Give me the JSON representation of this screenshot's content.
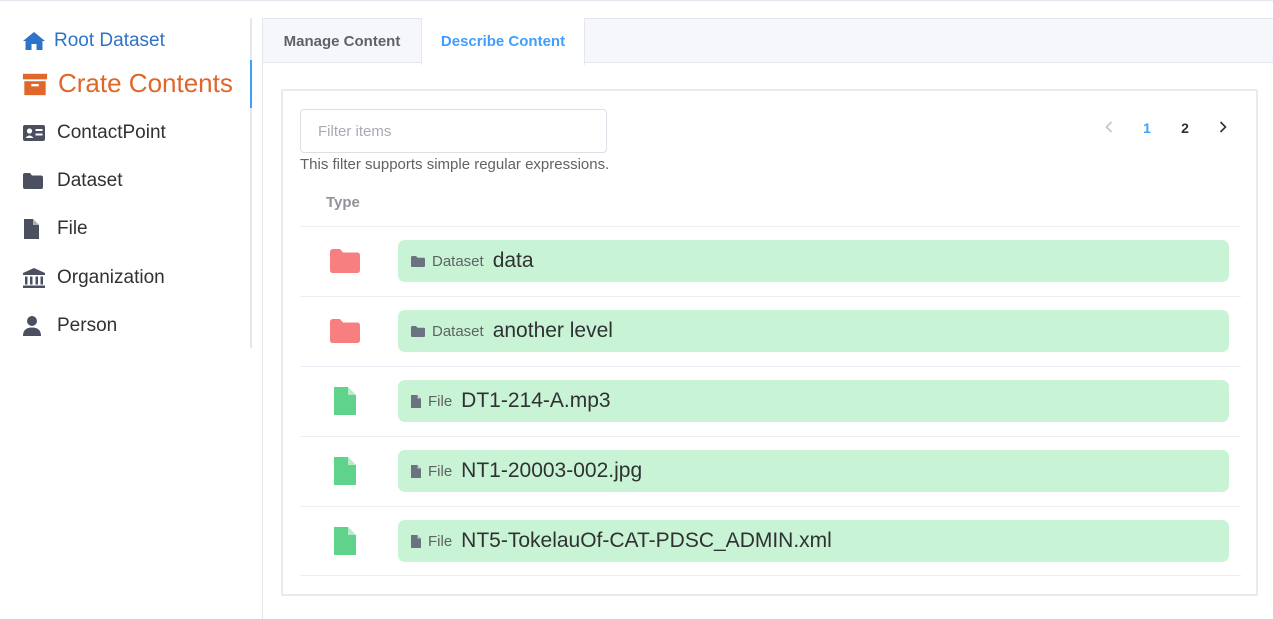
{
  "colors": {
    "accent": "#409eff",
    "root_link": "#2d73c9",
    "crate_orange": "#e0662a",
    "folder_red": "#f77f7f",
    "file_green": "#5fd38b",
    "pill_bg": "#c8f3d5"
  },
  "sidebar": {
    "root": {
      "label": "Root Dataset",
      "icon": "home-icon"
    },
    "crate": {
      "label": "Crate Contents",
      "icon": "archive-box-icon"
    },
    "items": [
      {
        "label": "ContactPoint",
        "icon": "id-card-icon"
      },
      {
        "label": "Dataset",
        "icon": "folder-icon"
      },
      {
        "label": "File",
        "icon": "file-icon"
      },
      {
        "label": "Organization",
        "icon": "institution-icon"
      },
      {
        "label": "Person",
        "icon": "person-icon"
      }
    ]
  },
  "tabs": [
    {
      "label": "Manage Content",
      "active": false
    },
    {
      "label": "Describe Content",
      "active": true
    }
  ],
  "filter": {
    "placeholder": "Filter items",
    "value": "",
    "hint": "This filter supports simple regular expressions."
  },
  "pagination": {
    "prev_icon": "chevron-left-icon",
    "next_icon": "chevron-right-icon",
    "pages": [
      "1",
      "2"
    ],
    "current": "1"
  },
  "table": {
    "header_type": "Type",
    "rows": [
      {
        "kind": "Dataset",
        "name": "data",
        "icon": "folder-icon"
      },
      {
        "kind": "Dataset",
        "name": "another level",
        "icon": "folder-icon"
      },
      {
        "kind": "File",
        "name": "DT1-214-A.mp3",
        "icon": "file-icon"
      },
      {
        "kind": "File",
        "name": "NT1-20003-002.jpg",
        "icon": "file-icon"
      },
      {
        "kind": "File",
        "name": "NT5-TokelauOf-CAT-PDSC_ADMIN.xml",
        "icon": "file-icon"
      }
    ]
  }
}
